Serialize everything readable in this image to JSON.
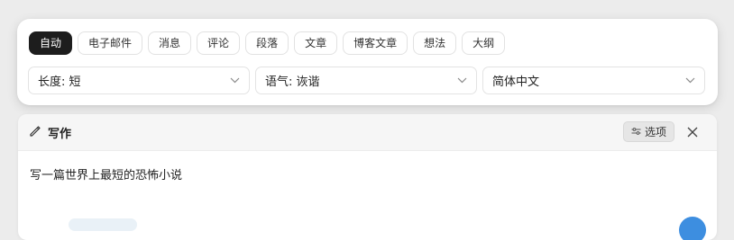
{
  "tabs": [
    {
      "label": "自动",
      "active": true
    },
    {
      "label": "电子邮件",
      "active": false
    },
    {
      "label": "消息",
      "active": false
    },
    {
      "label": "评论",
      "active": false
    },
    {
      "label": "段落",
      "active": false
    },
    {
      "label": "文章",
      "active": false
    },
    {
      "label": "博客文章",
      "active": false
    },
    {
      "label": "想法",
      "active": false
    },
    {
      "label": "大纲",
      "active": false
    }
  ],
  "selects": {
    "length": {
      "value": "长度: 短"
    },
    "tone": {
      "value": "语气: 诙谐"
    },
    "language": {
      "value": "简体中文"
    }
  },
  "write_panel": {
    "title": "写作",
    "options_label": "选项",
    "prompt": "写一篇世界上最短的恐怖小说"
  },
  "colors": {
    "active_tab_bg": "#1d1d1d",
    "header_bg": "#f6f6f6",
    "accent_blue": "#3d8ee0"
  },
  "icons": {
    "title_icon": "pencil-icon",
    "options_icon": "sliders-icon",
    "close_icon": "close-icon",
    "select_icon": "chevron-down-icon"
  }
}
